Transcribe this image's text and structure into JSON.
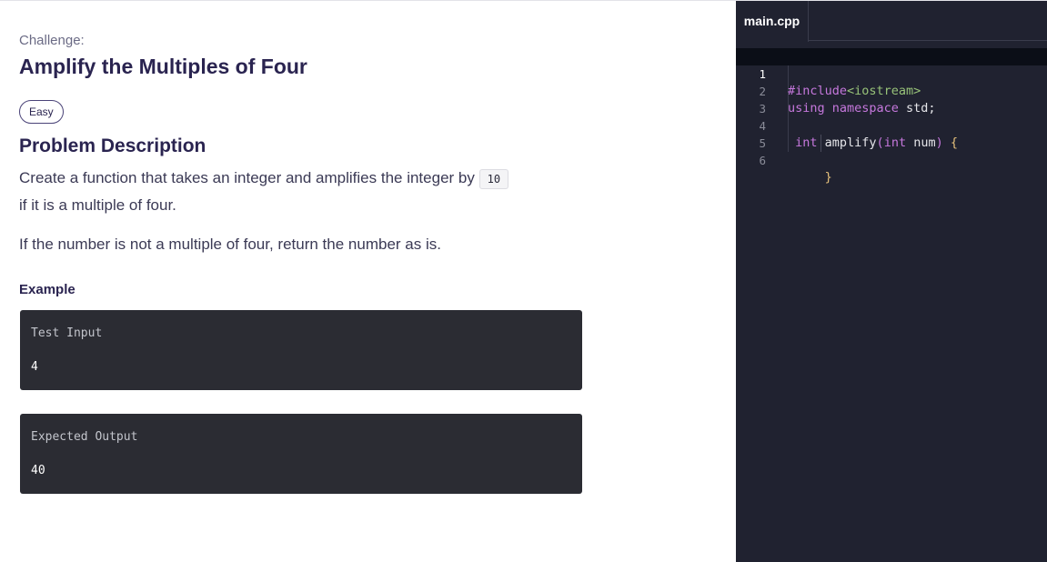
{
  "challenge": {
    "label": "Challenge:",
    "title": "Amplify the Multiples of Four",
    "difficulty": "Easy"
  },
  "problem": {
    "heading": "Problem Description",
    "text_before_code": "Create a function that takes an integer and amplifies the integer by ",
    "inline_code": "10",
    "text_after_code": "if it is a multiple of four.",
    "paragraph2": "If the number is not a multiple of four, return the number as is."
  },
  "example": {
    "heading": "Example",
    "input_label": "Test Input",
    "input_value": "4",
    "output_label": "Expected Output",
    "output_value": "40"
  },
  "editor": {
    "tab_name": "main.cpp",
    "line_numbers": [
      "1",
      "2",
      "3",
      "4",
      "5",
      "6"
    ],
    "lines": [
      {
        "p1": "#include",
        "p2": "<iostream>"
      },
      {
        "p1": "using namespace",
        "p2": " std;"
      },
      {
        "p1": ""
      },
      {
        "p1": " int",
        "p2": " amplify",
        "p3": "(",
        "p4": "int",
        "p5": " num",
        "p6": ")",
        "p7": " {"
      },
      {
        "p1": ""
      },
      {
        "p1": "     }"
      }
    ]
  }
}
